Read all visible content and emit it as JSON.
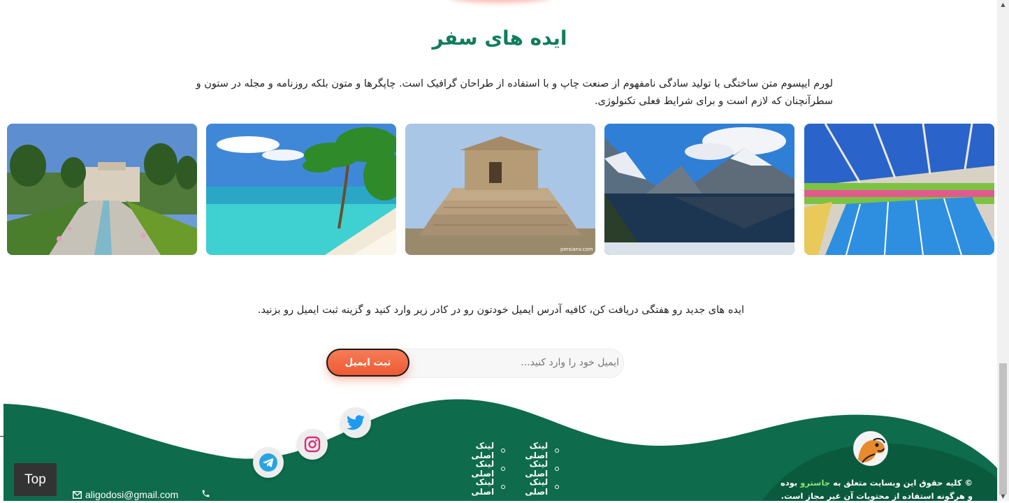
{
  "section": {
    "title": "ایده های سفر",
    "intro": "لورم ایپسوم متن ساختگی با تولید سادگی نامفهوم از صنعت چاپ و با استفاده از طراحان گرافیک است. چاپگرها و متون بلکه روزنامه و مجله در ستون و سطرآنچنان که لازم است و برای شرایط فعلی تکنولوژی."
  },
  "gallery": {
    "items": [
      {
        "name": "pool"
      },
      {
        "name": "mountain-lake"
      },
      {
        "name": "tomb-of-cyrus",
        "watermark": "persianv.com"
      },
      {
        "name": "tropical-beach"
      },
      {
        "name": "eram-garden"
      }
    ]
  },
  "newsletter": {
    "text": "ایده های جدید رو هفتگی دریافت کن، کافیه آدرس ایمیل خودتون رو در کادر زیر وارد کنید و گزینه ثبت ایمیل رو بزنید.",
    "placeholder": "ایمیل خود را وارد کنید...",
    "button_label": "ثبت ایمیل"
  },
  "footer": {
    "links": [
      [
        "لینک اصلی",
        "لینک اصلی"
      ],
      [
        "لینک اصلی",
        "لینک اصلی"
      ],
      [
        "لینک اصلی",
        "لینک اصلی"
      ]
    ],
    "copyright_pre": "© کلیه حقوق این وبسایت متعلق به",
    "brand": "جاسترو",
    "copyright_post": "بوده و هرگونه استفاده از محتویات آن غیر مجاز است.",
    "email": "aligodosi@gmail.com",
    "social": [
      "twitter-icon",
      "instagram-icon",
      "telegram-icon"
    ]
  },
  "top_button": "Top",
  "colors": {
    "title_green": "#0f7d5c",
    "footer_green": "#0e6b4b",
    "accent_orange": "#ee5a32",
    "brand_green": "#8ee26e"
  }
}
